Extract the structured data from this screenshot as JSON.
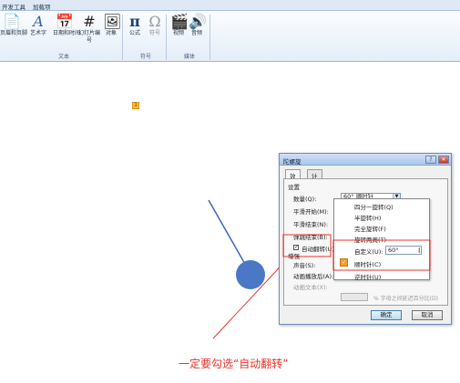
{
  "ribbon": {
    "tabs": [
      "开发工具",
      "加载项"
    ],
    "buttons": [
      {
        "label": "页眉和页脚",
        "icon": "header-footer-icon"
      },
      {
        "label": "艺术字",
        "icon": "wordart-icon"
      },
      {
        "label": "日期和时间",
        "icon": "date-time-icon"
      },
      {
        "label": "幻灯片编号",
        "icon": "slide-number-icon"
      },
      {
        "label": "对象",
        "icon": "object-icon"
      },
      {
        "label": "公式",
        "icon": "equation-icon"
      },
      {
        "label": "符号",
        "icon": "symbol-icon"
      },
      {
        "label": "视频",
        "icon": "video-icon"
      },
      {
        "label": "音频",
        "icon": "audio-icon"
      }
    ],
    "groups": [
      "文本",
      "符号",
      "媒体"
    ]
  },
  "dialog": {
    "title": "陀螺旋",
    "tabs": [
      "效果",
      "计时"
    ],
    "section_settings": "设置",
    "quantity_label": "数量(Q):",
    "quantity_value": "60°  顺时针",
    "smooth_start": "平滑开始(M):",
    "smooth_end": "平滑结束(N):",
    "bounce_end": "弹跳结束(B):",
    "auto_reverse": "自动翻转(U)",
    "section_enhance": "增强",
    "sound_label": "声音(S):",
    "after_anim_label": "动画播放后(A):",
    "anim_text_label": "动画文本(X):",
    "pct_label": "% 字母之间延迟百分比(D)",
    "ok": "确定",
    "cancel": "取消"
  },
  "dropdown": {
    "items": [
      "四分一旋转(Q)",
      "半旋转(H)",
      "完全旋转(F)",
      "旋转两周(T)",
      "自定义(U):",
      "顺时针(C)",
      "逆时针(U)"
    ],
    "custom_value": "60°"
  },
  "caption": "一定要勾选“自动翻转”",
  "colors": {
    "accent": "#e8332b",
    "shape": "#4a78c6",
    "line": "#3b69b7"
  }
}
